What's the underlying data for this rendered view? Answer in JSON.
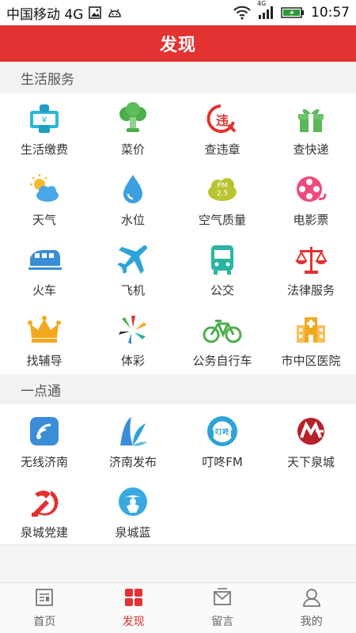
{
  "status_bar": {
    "carrier": "中国移动 4G",
    "network": "4G",
    "time": "10:57",
    "icons": [
      "image-icon",
      "android-icon",
      "wifi-icon",
      "signal-icon",
      "battery-icon"
    ]
  },
  "header": {
    "title": "发现"
  },
  "life_services": {
    "title": "生活服务",
    "items": [
      {
        "label": "生活缴费",
        "icon": "payment-icon"
      },
      {
        "label": "菜价",
        "icon": "vegetable-icon"
      },
      {
        "label": "查违章",
        "icon": "traffic-violation-icon"
      },
      {
        "label": "查快递",
        "icon": "gift-package-icon"
      },
      {
        "label": "天气",
        "icon": "weather-icon"
      },
      {
        "label": "水位",
        "icon": "water-drop-icon"
      },
      {
        "label": "空气质量",
        "icon": "air-quality-icon",
        "badge_top": "PM",
        "badge_bottom": "2.5"
      },
      {
        "label": "电影票",
        "icon": "film-reel-icon"
      },
      {
        "label": "火车",
        "icon": "train-icon"
      },
      {
        "label": "飞机",
        "icon": "airplane-icon"
      },
      {
        "label": "公交",
        "icon": "bus-icon"
      },
      {
        "label": "法律服务",
        "icon": "scales-icon"
      },
      {
        "label": "找辅导",
        "icon": "crown-icon"
      },
      {
        "label": "体彩",
        "icon": "lottery-icon"
      },
      {
        "label": "公务自行车",
        "icon": "bicycle-icon"
      },
      {
        "label": "市中区医院",
        "icon": "hospital-icon"
      }
    ]
  },
  "one_stop": {
    "title": "一点通",
    "items": [
      {
        "label": "无线济南",
        "icon": "wireless-jinan-icon"
      },
      {
        "label": "济南发布",
        "icon": "jinan-release-icon"
      },
      {
        "label": "叮咚FM",
        "icon": "dingdong-fm-icon",
        "badge": "叮咚"
      },
      {
        "label": "天下泉城",
        "icon": "tianxia-quancheng-icon"
      },
      {
        "label": "泉城党建",
        "icon": "party-emblem-icon"
      },
      {
        "label": "泉城蓝",
        "icon": "quancheng-blue-icon"
      }
    ]
  },
  "tabbar": {
    "items": [
      {
        "label": "首页",
        "icon": "home-news-icon",
        "active": false
      },
      {
        "label": "发现",
        "icon": "discover-grid-icon",
        "active": true
      },
      {
        "label": "留言",
        "icon": "message-icon",
        "active": false
      },
      {
        "label": "我的",
        "icon": "profile-icon",
        "active": false
      }
    ]
  },
  "colors": {
    "accent": "#e23231",
    "section_bg": "#f2f2f2"
  }
}
